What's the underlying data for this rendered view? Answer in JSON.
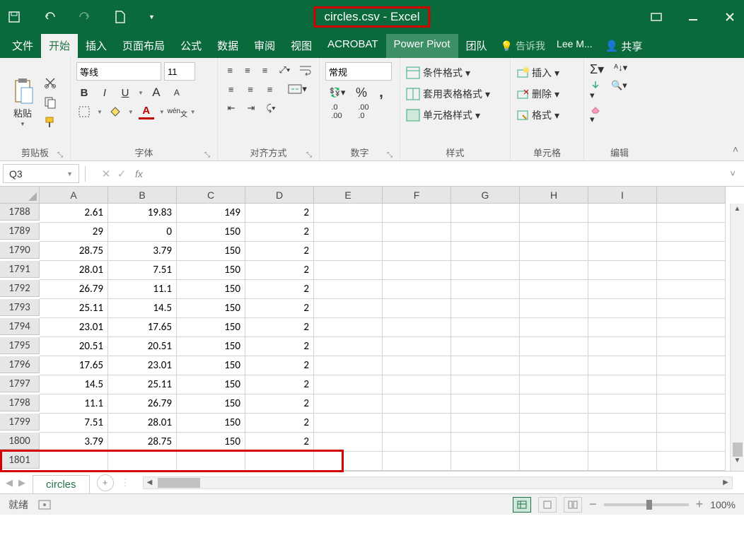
{
  "title": "circles.csv - Excel",
  "tabs": [
    "文件",
    "开始",
    "插入",
    "页面布局",
    "公式",
    "数据",
    "审阅",
    "视图",
    "ACROBAT",
    "Power Pivot",
    "团队"
  ],
  "activeTab": 1,
  "tellMe": "告诉我",
  "user": "Lee M...",
  "share": "共享",
  "ribbon": {
    "clipboard": {
      "paste": "粘贴",
      "label": "剪贴板"
    },
    "font": {
      "name": "等线",
      "size": "11",
      "label": "字体",
      "wen": "wén"
    },
    "align": {
      "label": "对齐方式"
    },
    "number": {
      "format": "常规",
      "label": "数字"
    },
    "styles": {
      "cond": "条件格式",
      "table": "套用表格格式",
      "cell": "单元格样式",
      "label": "样式"
    },
    "cells": {
      "insert": "插入",
      "delete": "删除",
      "format": "格式",
      "label": "单元格"
    },
    "editing": {
      "label": "编辑"
    }
  },
  "nameBox": "Q3",
  "columns": [
    "A",
    "B",
    "C",
    "D",
    "E",
    "F",
    "G",
    "H",
    "I",
    ""
  ],
  "rows": [
    {
      "n": "1788",
      "c": [
        "2.61",
        "19.83",
        "149",
        "2",
        "",
        "",
        "",
        "",
        "",
        ""
      ]
    },
    {
      "n": "1789",
      "c": [
        "29",
        "0",
        "150",
        "2",
        "",
        "",
        "",
        "",
        "",
        ""
      ]
    },
    {
      "n": "1790",
      "c": [
        "28.75",
        "3.79",
        "150",
        "2",
        "",
        "",
        "",
        "",
        "",
        ""
      ]
    },
    {
      "n": "1791",
      "c": [
        "28.01",
        "7.51",
        "150",
        "2",
        "",
        "",
        "",
        "",
        "",
        ""
      ]
    },
    {
      "n": "1792",
      "c": [
        "26.79",
        "11.1",
        "150",
        "2",
        "",
        "",
        "",
        "",
        "",
        ""
      ]
    },
    {
      "n": "1793",
      "c": [
        "25.11",
        "14.5",
        "150",
        "2",
        "",
        "",
        "",
        "",
        "",
        ""
      ]
    },
    {
      "n": "1794",
      "c": [
        "23.01",
        "17.65",
        "150",
        "2",
        "",
        "",
        "",
        "",
        "",
        ""
      ]
    },
    {
      "n": "1795",
      "c": [
        "20.51",
        "20.51",
        "150",
        "2",
        "",
        "",
        "",
        "",
        "",
        ""
      ]
    },
    {
      "n": "1796",
      "c": [
        "17.65",
        "23.01",
        "150",
        "2",
        "",
        "",
        "",
        "",
        "",
        ""
      ]
    },
    {
      "n": "1797",
      "c": [
        "14.5",
        "25.11",
        "150",
        "2",
        "",
        "",
        "",
        "",
        "",
        ""
      ]
    },
    {
      "n": "1798",
      "c": [
        "11.1",
        "26.79",
        "150",
        "2",
        "",
        "",
        "",
        "",
        "",
        ""
      ]
    },
    {
      "n": "1799",
      "c": [
        "7.51",
        "28.01",
        "150",
        "2",
        "",
        "",
        "",
        "",
        "",
        ""
      ]
    },
    {
      "n": "1800",
      "c": [
        "3.79",
        "28.75",
        "150",
        "2",
        "",
        "",
        "",
        "",
        "",
        ""
      ]
    },
    {
      "n": "1801",
      "c": [
        "",
        "",
        "",
        "",
        "",
        "",
        "",
        "",
        "",
        ""
      ]
    }
  ],
  "sheet": "circles",
  "status": {
    "ready": "就绪",
    "zoom": "100%"
  }
}
